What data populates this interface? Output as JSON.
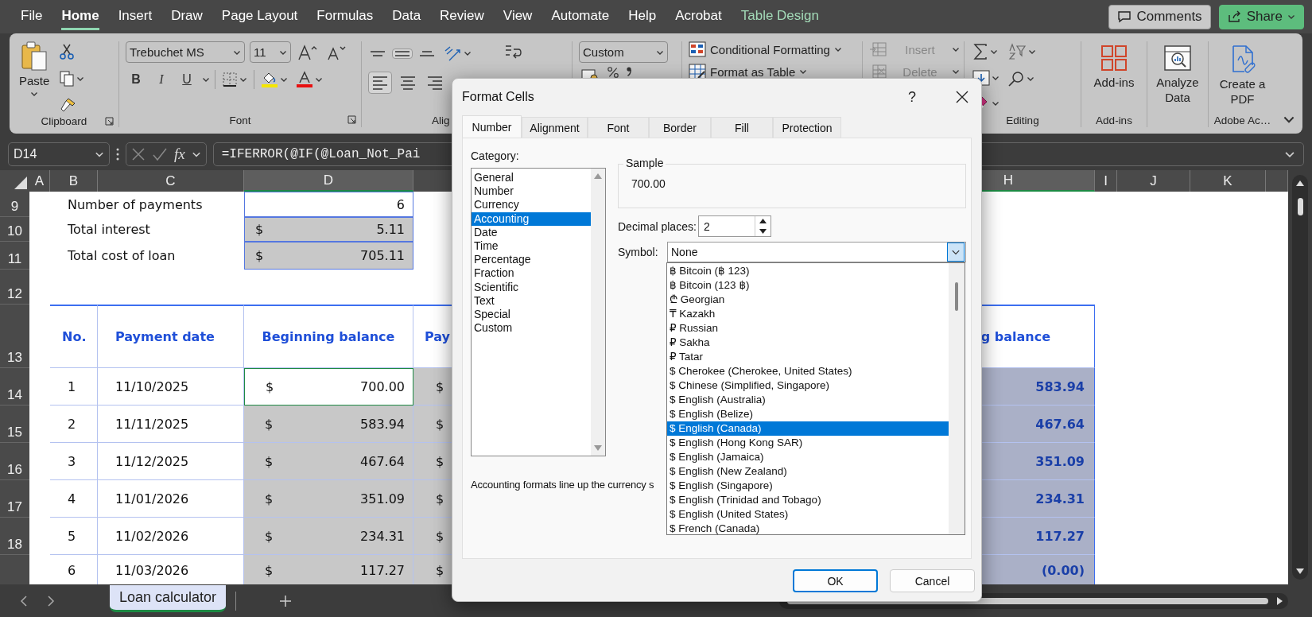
{
  "menu": {
    "tabs": [
      {
        "label": "File",
        "kind": "tab",
        "selected": false
      },
      {
        "label": "Home",
        "kind": "tab",
        "selected": true
      },
      {
        "label": "Insert",
        "kind": "tab",
        "selected": false
      },
      {
        "label": "Draw",
        "kind": "tab",
        "selected": false
      },
      {
        "label": "Page Layout",
        "kind": "tab",
        "selected": false
      },
      {
        "label": "Formulas",
        "kind": "tab",
        "selected": false
      },
      {
        "label": "Data",
        "kind": "tab",
        "selected": false
      },
      {
        "label": "Review",
        "kind": "tab",
        "selected": false
      },
      {
        "label": "View",
        "kind": "tab",
        "selected": false
      },
      {
        "label": "Automate",
        "kind": "tab",
        "selected": false
      },
      {
        "label": "Help",
        "kind": "tab",
        "selected": false
      },
      {
        "label": "Acrobat",
        "kind": "tab",
        "selected": false
      },
      {
        "label": "Table Design",
        "kind": "contextual",
        "selected": false
      }
    ],
    "comments": "Comments",
    "share": "Share"
  },
  "ribbon": {
    "clipboard": {
      "paste": "Paste",
      "label": "Clipboard"
    },
    "font": {
      "name": "Trebuchet MS",
      "size": "11",
      "format_buttons": [
        "B",
        "I",
        "U"
      ],
      "label": "Font"
    },
    "alignment": {
      "label": "Alig"
    },
    "number": {
      "format": "Custom"
    },
    "styles": {
      "items": [
        "Conditional Formatting",
        "Format as Table"
      ]
    },
    "cells": {
      "items": [
        {
          "label": "Insert",
          "disabled": true
        },
        {
          "label": "Delete",
          "disabled": true
        }
      ]
    },
    "editing": {
      "label": "Editing"
    },
    "add_ins": {
      "button": "Add-ins",
      "label": "Add-ins"
    },
    "analyze": {
      "button": "Analyze Data"
    },
    "adobe": {
      "button": "Create a PDF",
      "label": "Adobe Ac…"
    }
  },
  "formula_bar": {
    "name_box": "D14",
    "fx": "fx",
    "formula": "=IFERROR(@IF(@Loan_Not_Pai"
  },
  "sheet": {
    "columns": [
      {
        "label": "A",
        "selected": false
      },
      {
        "label": "B",
        "selected": false
      },
      {
        "label": "C",
        "selected": false
      },
      {
        "label": "D",
        "selected": true
      },
      {
        "label": "H",
        "selected": true
      },
      {
        "label": "I",
        "selected": false
      },
      {
        "label": "J",
        "selected": false
      },
      {
        "label": "K",
        "selected": false
      }
    ],
    "row_numbers": [
      "9",
      "10",
      "11",
      "12",
      "13",
      "14",
      "15",
      "16",
      "17",
      "18"
    ],
    "summary": [
      {
        "label": "Number of payments",
        "value": "6",
        "shaded": false
      },
      {
        "label": "Total interest",
        "symbol": "$",
        "value": "5.11",
        "shaded": true
      },
      {
        "label": "Total cost of loan",
        "symbol": "$",
        "value": "705.11",
        "shaded": true
      }
    ],
    "table_header": {
      "no": "No.",
      "payment_date": "Payment date",
      "beginning_balance": "Beginning balance",
      "column_e": "Pay",
      "column_h": "g balance"
    },
    "rows": [
      {
        "no": "1",
        "payment_date": "11/10/2025",
        "symbol": "$",
        "beginning_balance": "700.00",
        "column_e": "$",
        "column_h": "583.94",
        "active": true
      },
      {
        "no": "2",
        "payment_date": "11/11/2025",
        "symbol": "$",
        "beginning_balance": "583.94",
        "column_e": "$",
        "column_h": "467.64",
        "active": false
      },
      {
        "no": "3",
        "payment_date": "11/12/2025",
        "symbol": "$",
        "beginning_balance": "467.64",
        "column_e": "$",
        "column_h": "351.09",
        "active": false
      },
      {
        "no": "4",
        "payment_date": "11/01/2026",
        "symbol": "$",
        "beginning_balance": "351.09",
        "column_e": "$",
        "column_h": "234.31",
        "active": false
      },
      {
        "no": "5",
        "payment_date": "11/02/2026",
        "symbol": "$",
        "beginning_balance": "234.31",
        "column_e": "$",
        "column_h": "117.27",
        "active": false
      },
      {
        "no": "6",
        "payment_date": "11/03/2026",
        "symbol": "$",
        "beginning_balance": "117.27",
        "column_e": "$",
        "column_h": "(0.00)",
        "active": false
      }
    ]
  },
  "sheet_tabs": [
    {
      "label": "Loan calculator",
      "selected": true
    }
  ],
  "dialog": {
    "title": "Format Cells",
    "help": "?",
    "tabs": [
      {
        "label": "Number",
        "selected": true
      },
      {
        "label": "Alignment",
        "selected": false
      },
      {
        "label": "Font",
        "selected": false
      },
      {
        "label": "Border",
        "selected": false
      },
      {
        "label": "Fill",
        "selected": false
      },
      {
        "label": "Protection",
        "selected": false
      }
    ],
    "category_label": "Category:",
    "categories": [
      {
        "label": "General",
        "selected": false
      },
      {
        "label": "Number",
        "selected": false
      },
      {
        "label": "Currency",
        "selected": false
      },
      {
        "label": "Accounting",
        "selected": true
      },
      {
        "label": "Date",
        "selected": false
      },
      {
        "label": "Time",
        "selected": false
      },
      {
        "label": "Percentage",
        "selected": false
      },
      {
        "label": "Fraction",
        "selected": false
      },
      {
        "label": "Scientific",
        "selected": false
      },
      {
        "label": "Text",
        "selected": false
      },
      {
        "label": "Special",
        "selected": false
      },
      {
        "label": "Custom",
        "selected": false
      }
    ],
    "sample_label": "Sample",
    "sample": "700.00",
    "decimal_label": "Decimal places:",
    "decimal_places": "2",
    "symbol_label": "Symbol:",
    "symbol": "None",
    "symbols": [
      {
        "label": "฿ Bitcoin (฿ 123)",
        "selected": false
      },
      {
        "label": "฿ Bitcoin (123 ฿)",
        "selected": false
      },
      {
        "label": "₾ Georgian",
        "selected": false
      },
      {
        "label": "₸ Kazakh",
        "selected": false
      },
      {
        "label": "₽ Russian",
        "selected": false
      },
      {
        "label": "₽ Sakha",
        "selected": false
      },
      {
        "label": "₽ Tatar",
        "selected": false
      },
      {
        "label": "$ Cherokee (Cherokee, United States)",
        "selected": false
      },
      {
        "label": "$ Chinese (Simplified, Singapore)",
        "selected": false
      },
      {
        "label": "$ English (Australia)",
        "selected": false
      },
      {
        "label": "$ English (Belize)",
        "selected": false
      },
      {
        "label": "$ English (Canada)",
        "selected": true
      },
      {
        "label": "$ English (Hong Kong SAR)",
        "selected": false
      },
      {
        "label": "$ English (Jamaica)",
        "selected": false
      },
      {
        "label": "$ English (New Zealand)",
        "selected": false
      },
      {
        "label": "$ English (Singapore)",
        "selected": false
      },
      {
        "label": "$ English (Trinidad and Tobago)",
        "selected": false
      },
      {
        "label": "$ English (United States)",
        "selected": false
      },
      {
        "label": "$ French (Canada)",
        "selected": false
      }
    ],
    "description": "Accounting formats line up the currency s",
    "ok": "OK",
    "cancel": "Cancel"
  }
}
